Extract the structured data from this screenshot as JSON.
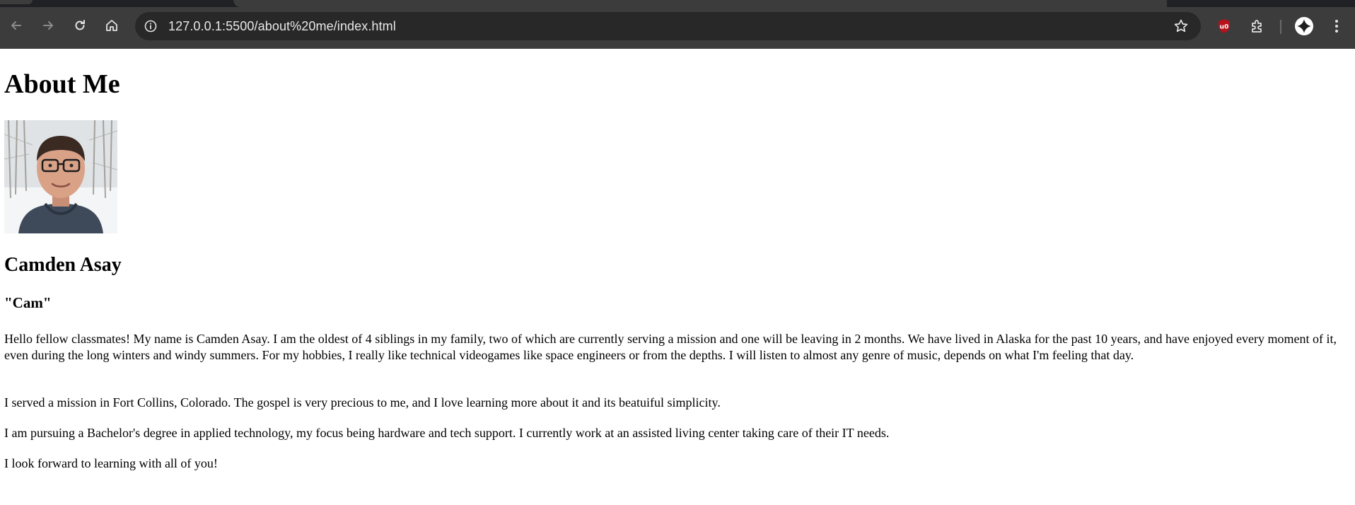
{
  "browser": {
    "url": "127.0.0.1:5500/about%20me/index.html",
    "icons": {
      "back": "arrow-left-icon",
      "forward": "arrow-right-icon",
      "reload": "reload-icon",
      "home": "home-icon",
      "site_info": "info-icon",
      "bookmark": "star-icon",
      "ublock": "ublock-shield-icon",
      "extensions": "puzzle-icon",
      "gemini": "sparkle-icon",
      "menu": "kebab-menu-icon"
    },
    "ublock_badge_color": "#b5121b"
  },
  "page": {
    "title": "About Me",
    "name": "Camden Asay",
    "nickname": "\"Cam\"",
    "paragraphs": [
      "Hello fellow classmates! My name is Camden Asay. I am the oldest of 4 siblings in my family, two of which are currently serving a mission and one will be leaving in 2 months. We have lived in Alaska for the past 10 years, and have enjoyed every moment of it, even during the long winters and windy summers. For my hobbies, I really like technical videogames like space engineers or from the depths. I will listen to almost any genre of music, depends on what I'm feeling that day.",
      "I served a mission in Fort Collins, Colorado. The gospel is very precious to me, and I love learning more about it and its beatuiful simplicity.",
      "I am pursuing a Bachelor's degree in applied technology, my focus being hardware and tech support. I currently work at an assisted living center taking care of their IT needs.",
      "I look forward to learning with all of you!"
    ]
  }
}
